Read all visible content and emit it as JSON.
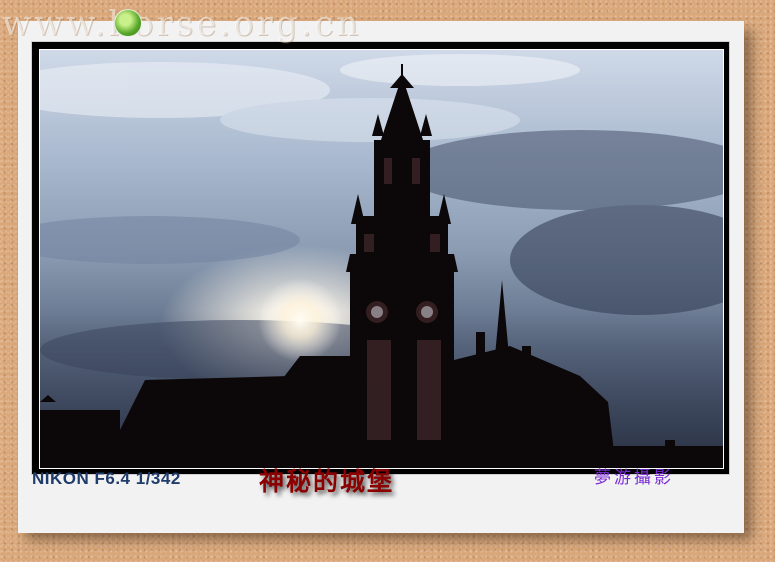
{
  "watermark": {
    "text": "www.horse.org.cn"
  },
  "caption": {
    "camera": "NIKON F6.4 1/342",
    "title": "神秘的城堡",
    "credit": "夢游攝影"
  },
  "colors": {
    "background": "#d9a77a",
    "card": "#f2f2f2",
    "camera_text": "#1f3c6a",
    "title_text": "#8b0000",
    "credit_text": "#7a2bd6"
  }
}
